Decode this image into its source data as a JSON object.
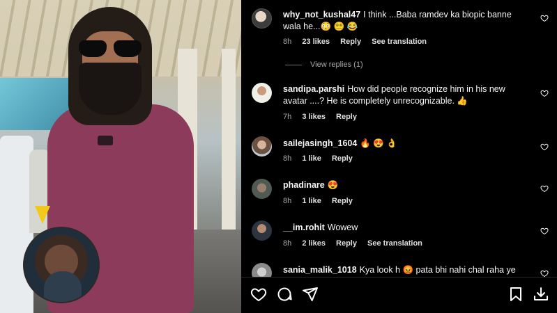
{
  "comments": [
    {
      "username": "why_not_kushal47",
      "text": "I think ...Baba ramdev ka biopic banne wala he...😳 😵‍💫 😂",
      "time": "8h",
      "likes": "23 likes",
      "reply": "Reply",
      "translate": "See translation",
      "view_replies": "View replies (1)"
    },
    {
      "username": "sandipa.parshi",
      "text": "How did people recognize him in his new avatar ....? He is completely unrecognizable. 👍",
      "time": "7h",
      "likes": "3 likes",
      "reply": "Reply"
    },
    {
      "username": "sailejasingh_1604",
      "text": "🔥 😍 👌",
      "time": "8h",
      "likes": "1 like",
      "reply": "Reply"
    },
    {
      "username": "phadinare",
      "text": "😍",
      "time": "8h",
      "likes": "1 like",
      "reply": "Reply"
    },
    {
      "username": "__im.rohit",
      "text": "Wowew",
      "time": "8h",
      "likes": "2 likes",
      "reply": "Reply",
      "translate": "See translation"
    },
    {
      "username": "sania_malik_1018",
      "text": "Kya look h 😡 pata bhi nahi chal raha ye"
    }
  ],
  "icons": {
    "like": "heart-icon",
    "comment": "comment-icon",
    "share": "share-icon",
    "save": "bookmark-icon",
    "download": "download-icon"
  },
  "colors": {
    "background": "#000000",
    "text": "#f5f5f5",
    "meta": "#a8a8a8"
  }
}
